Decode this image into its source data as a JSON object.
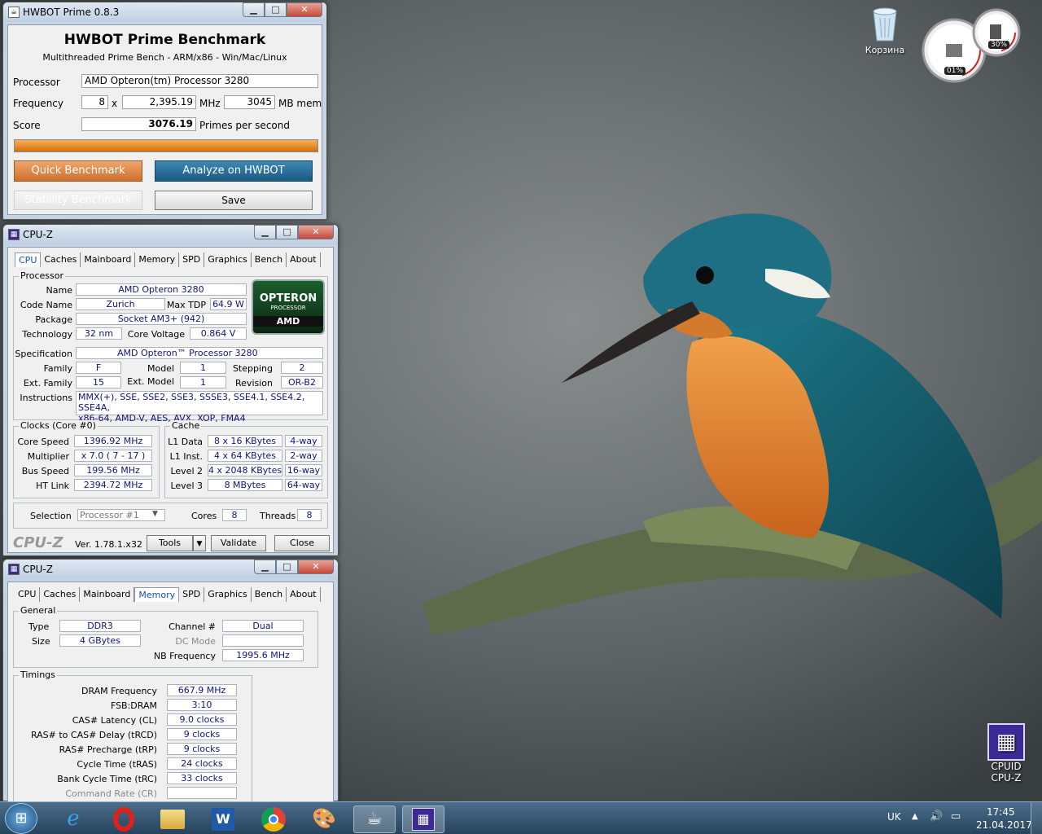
{
  "hwbot": {
    "title": "HWBOT Prime 0.8.3",
    "heading": "HWBOT Prime Benchmark",
    "subheading": "Multithreaded Prime Bench - ARM/x86 - Win/Mac/Linux",
    "processor_label": "Processor",
    "processor_value": "AMD Opteron(tm) Processor 3280",
    "frequency_label": "Frequency",
    "cores_value": "8",
    "x": "x",
    "freq_value": "2,395.19",
    "mhz": "MHz",
    "mem_value": "3045",
    "mem_unit": "MB mem",
    "score_label": "Score",
    "score_value": "3076.19",
    "score_unit": "Primes per second",
    "progress": 1.0,
    "quick_btn": "Quick Benchmark",
    "analyze_btn": "Analyze on HWBOT",
    "stability_btn": "Stability Benchmark",
    "save_btn": "Save"
  },
  "cpuz1": {
    "title": "CPU-Z",
    "tabs": [
      "CPU",
      "Caches",
      "Mainboard",
      "Memory",
      "SPD",
      "Graphics",
      "Bench",
      "About"
    ],
    "processor_group": "Processor",
    "name_l": "Name",
    "name": "AMD Opteron 3280",
    "codename_l": "Code Name",
    "codename": "Zurich",
    "maxtdp_l": "Max TDP",
    "maxtdp": "64.9 W",
    "package_l": "Package",
    "package": "Socket AM3+ (942)",
    "tech_l": "Technology",
    "tech": "32 nm",
    "voltage_l": "Core Voltage",
    "voltage": "0.864 V",
    "logo_top": "OPTERON",
    "logo_mid": "PROCESSOR",
    "logo_bot": "AMD",
    "spec_l": "Specification",
    "spec": "AMD Opteron™ Processor 3280",
    "family_l": "Family",
    "family": "F",
    "model_l": "Model",
    "model": "1",
    "stepping_l": "Stepping",
    "stepping": "2",
    "extfam_l": "Ext. Family",
    "extfam": "15",
    "extmodel_l": "Ext. Model",
    "extmodel": "1",
    "revision_l": "Revision",
    "revision": "OR-B2",
    "instr_l": "Instructions",
    "instr1": "MMX(+), SSE, SSE2, SSE3, SSSE3, SSE4.1, SSE4.2, SSE4A,",
    "instr2": "x86-64, AMD-V, AES, AVX, XOP, FMA4",
    "clocks_group": "Clocks (Core #0)",
    "corespeed_l": "Core Speed",
    "corespeed": "1396.92 MHz",
    "mult_l": "Multiplier",
    "mult": "x 7.0 ( 7 - 17 )",
    "bus_l": "Bus Speed",
    "bus": "199.56 MHz",
    "ht_l": "HT Link",
    "ht": "2394.72 MHz",
    "cache_group": "Cache",
    "l1d_l": "L1 Data",
    "l1d": "8 x 16 KBytes",
    "l1d_w": "4-way",
    "l1i_l": "L1 Inst.",
    "l1i": "4 x 64 KBytes",
    "l1i_w": "2-way",
    "l2_l": "Level 2",
    "l2": "4 x 2048 KBytes",
    "l2_w": "16-way",
    "l3_l": "Level 3",
    "l3": "8 MBytes",
    "l3_w": "64-way",
    "selection_l": "Selection",
    "selection": "Processor #1",
    "cores_l": "Cores",
    "cores": "8",
    "threads_l": "Threads",
    "threads": "8",
    "brand": "CPU-Z",
    "version": "Ver. 1.78.1.x32",
    "tools": "Tools",
    "validate": "Validate",
    "close": "Close"
  },
  "cpuz2": {
    "title": "CPU-Z",
    "tabs": [
      "CPU",
      "Caches",
      "Mainboard",
      "Memory",
      "SPD",
      "Graphics",
      "Bench",
      "About"
    ],
    "general_group": "General",
    "type_l": "Type",
    "type": "DDR3",
    "channel_l": "Channel #",
    "channel": "Dual",
    "size_l": "Size",
    "size": "4 GBytes",
    "dcmode_l": "DC Mode",
    "dcmode": "",
    "nbfreq_l": "NB Frequency",
    "nbfreq": "1995.6 MHz",
    "timings_group": "Timings",
    "timings": [
      {
        "label": "DRAM Frequency",
        "value": "667.9 MHz"
      },
      {
        "label": "FSB:DRAM",
        "value": "3:10"
      },
      {
        "label": "CAS# Latency (CL)",
        "value": "9.0 clocks"
      },
      {
        "label": "RAS# to CAS# Delay (tRCD)",
        "value": "9 clocks"
      },
      {
        "label": "RAS# Precharge (tRP)",
        "value": "9 clocks"
      },
      {
        "label": "Cycle Time (tRAS)",
        "value": "24 clocks"
      },
      {
        "label": "Bank Cycle Time (tRC)",
        "value": "33 clocks"
      },
      {
        "label": "Command Rate (CR)",
        "value": ""
      }
    ]
  },
  "desktop": {
    "recycle": "Корзина",
    "gadget_cpu": "01%",
    "gadget_mem": "30%",
    "cpuz_icon_l1": "CPUID",
    "cpuz_icon_l2": "CPU-Z"
  },
  "tray": {
    "lang": "UK",
    "time": "17:45",
    "date": "21.04.2017"
  }
}
